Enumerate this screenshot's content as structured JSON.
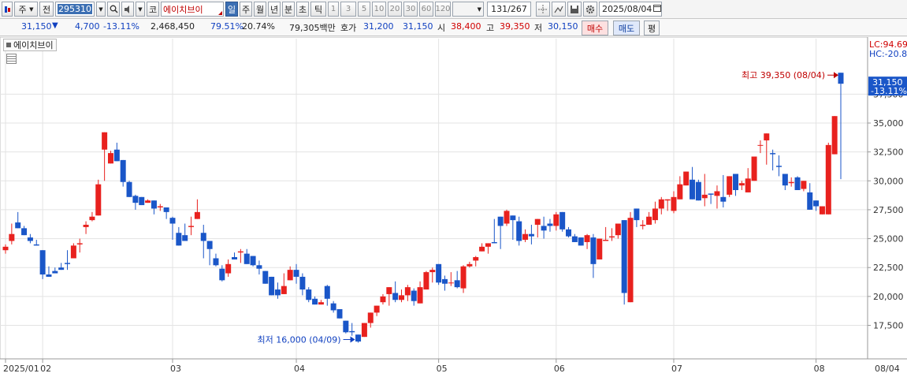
{
  "toolbar": {
    "market_label": "주",
    "prev_label": "전",
    "code": "295310",
    "name": "에이치브이",
    "periods": [
      "일",
      "주",
      "월",
      "년",
      "분",
      "초",
      "틱"
    ],
    "active_period": "일",
    "minute_options": [
      "1",
      "3",
      "5",
      "10",
      "20",
      "30",
      "60",
      "120"
    ],
    "count": "131",
    "total": "/267",
    "date": "2025/08/04",
    "ko_label": "코"
  },
  "quote": {
    "price": "31,150",
    "change": "4,700",
    "change_rate": "-13.11%",
    "volume": "2,468,450",
    "vol_ratio": "79.51%",
    "turnover": "20.74%",
    "amount": "79,305백만",
    "bid_label": "호가",
    "bid": "31,200",
    "ask": "31,150",
    "open_label": "시",
    "open": "38,400",
    "high_label": "고",
    "high": "39,350",
    "low_label": "저",
    "low": "30,150",
    "buy_label": "매수",
    "sell_label": "매도",
    "eval_label": "평"
  },
  "chart_data": {
    "type": "candlestick",
    "title": "에이치브이",
    "ylim": [
      14600,
      42300
    ],
    "y_ticks": [
      37500,
      35000,
      32500,
      30000,
      27500,
      25000,
      22500,
      20000,
      17500
    ],
    "y_tick_labels": [
      "37,500",
      "35,000",
      "32,500",
      "30,000",
      "27,500",
      "25,000",
      "22,500",
      "20,000",
      "17,500"
    ],
    "x_labels": [
      {
        "label": "2025/01",
        "index": 0
      },
      {
        "label": "02",
        "index": 6
      },
      {
        "label": "03",
        "index": 27
      },
      {
        "label": "04",
        "index": 47
      },
      {
        "label": "05",
        "index": 70
      },
      {
        "label": "06",
        "index": 89
      },
      {
        "label": "07",
        "index": 108
      },
      {
        "label": "08",
        "index": 131
      }
    ],
    "x_end_label": "08/04",
    "lc_label": "LC:94.69",
    "hc_label": "HC:-20.8",
    "current_price": "31,150",
    "current_rate": "-13.11%",
    "max_annotation": "최고 39,350 (08/04)",
    "min_annotation": "최저 16,000 (04/09)",
    "candles": [
      [
        24000,
        24300,
        23700,
        24500
      ],
      [
        24800,
        25400,
        24500,
        26300
      ],
      [
        26400,
        25900,
        26700,
        27300
      ],
      [
        25900,
        25300,
        26100,
        25300
      ],
      [
        25100,
        24800,
        25400,
        24600
      ],
      [
        24500,
        24400,
        24800,
        24900
      ],
      [
        24000,
        21900,
        24000,
        21500
      ],
      [
        21900,
        21700,
        22100,
        22600
      ],
      [
        22200,
        22000,
        22500,
        22300
      ],
      [
        22500,
        22300,
        22900,
        22500
      ],
      [
        22900,
        22800,
        24000,
        22300
      ],
      [
        23300,
        24400,
        24600,
        23500
      ],
      [
        24500,
        24600,
        25000,
        23800
      ],
      [
        26000,
        26200,
        26500,
        25400
      ],
      [
        26600,
        26900,
        27300,
        26500
      ],
      [
        27000,
        29700,
        30100,
        27100
      ],
      [
        32700,
        34200,
        30000,
        30100
      ],
      [
        31500,
        32400,
        32000,
        32600
      ],
      [
        32700,
        31700,
        33300,
        31700
      ],
      [
        31800,
        29900,
        31800,
        29500
      ],
      [
        29900,
        28600,
        30000,
        28700
      ],
      [
        28700,
        28100,
        28800,
        27500
      ],
      [
        28600,
        27900,
        28600,
        28400
      ],
      [
        28100,
        28300,
        28400,
        28300
      ],
      [
        28300,
        27600,
        28100,
        27100
      ],
      [
        27700,
        27800,
        28000,
        27400
      ],
      [
        27700,
        27300,
        27400,
        26700
      ],
      [
        26800,
        26300,
        26900,
        24900
      ],
      [
        25500,
        24400,
        26000,
        24600
      ],
      [
        25300,
        24800,
        26300,
        24900
      ],
      [
        26000,
        26100,
        26900,
        25300
      ],
      [
        26700,
        27300,
        28400,
        27400
      ],
      [
        25500,
        24800,
        26200,
        23300
      ],
      [
        24800,
        24100,
        24600,
        22700
      ],
      [
        23300,
        22700,
        23700,
        22600
      ],
      [
        22400,
        21400,
        22700,
        21300
      ],
      [
        22000,
        22800,
        23200,
        21700
      ],
      [
        23400,
        23200,
        23800,
        23200
      ],
      [
        23800,
        23900,
        24100,
        22900
      ],
      [
        23700,
        22800,
        24100,
        23200
      ],
      [
        23500,
        22700,
        23000,
        22600
      ],
      [
        22700,
        22400,
        23100,
        21900
      ],
      [
        22200,
        21100,
        22200,
        21400
      ],
      [
        21700,
        20100,
        21700,
        20200
      ],
      [
        20600,
        20100,
        21200,
        19800
      ],
      [
        20200,
        20900,
        22000,
        20700
      ],
      [
        21400,
        22300,
        22600,
        22000
      ],
      [
        22300,
        21700,
        22800,
        21100
      ],
      [
        21700,
        20600,
        22000,
        20100
      ],
      [
        20600,
        19700,
        20800,
        19500
      ],
      [
        19800,
        19300,
        20000,
        19400
      ],
      [
        19300,
        19500,
        19700,
        19500
      ],
      [
        20900,
        19800,
        21000,
        19200
      ],
      [
        19400,
        18800,
        19600,
        18600
      ],
      [
        18900,
        18100,
        18900,
        18100
      ],
      [
        17900,
        16900,
        17900,
        16800
      ],
      [
        17000,
        16900,
        17700,
        16600
      ],
      [
        16700,
        16100,
        16700,
        16000
      ],
      [
        16500,
        17700,
        17600,
        16600
      ],
      [
        17700,
        18600,
        18600,
        17300
      ],
      [
        18600,
        19200,
        19200,
        18300
      ],
      [
        19500,
        20000,
        20200,
        19300
      ],
      [
        20200,
        20800,
        20800,
        19200
      ],
      [
        20300,
        19700,
        21300,
        19500
      ],
      [
        19700,
        20100,
        20600,
        19500
      ],
      [
        20100,
        20800,
        21000,
        19600
      ],
      [
        20500,
        19600,
        20700,
        19200
      ],
      [
        19400,
        20800,
        21300,
        19400
      ],
      [
        20600,
        22100,
        22200,
        21200
      ],
      [
        22100,
        22300,
        22500,
        21200
      ],
      [
        22800,
        21200,
        22600,
        21000
      ],
      [
        21500,
        21100,
        21800,
        20500
      ],
      [
        21200,
        21200,
        22100,
        20900
      ],
      [
        21400,
        20800,
        22200,
        20700
      ],
      [
        20700,
        22600,
        22700,
        20300
      ],
      [
        22600,
        22800,
        23000,
        22500
      ],
      [
        23100,
        23400,
        23500,
        22600
      ],
      [
        23900,
        24300,
        24600,
        23900
      ],
      [
        24300,
        24600,
        24600,
        23700
      ],
      [
        24700,
        24600,
        26700,
        24600
      ],
      [
        26900,
        26100,
        26900,
        24100
      ],
      [
        26300,
        27400,
        27500,
        26100
      ],
      [
        27000,
        26600,
        26500,
        24900
      ],
      [
        26500,
        24800,
        26900,
        24400
      ],
      [
        24900,
        25400,
        25800,
        24700
      ],
      [
        25400,
        25200,
        26200,
        24500
      ],
      [
        26200,
        26700,
        26700,
        25100
      ],
      [
        26100,
        25700,
        26900,
        25000
      ],
      [
        26300,
        26100,
        26700,
        25600
      ],
      [
        26100,
        27100,
        27300,
        25700
      ],
      [
        27300,
        25800,
        27100,
        25600
      ],
      [
        25800,
        25200,
        26000,
        25100
      ],
      [
        25200,
        24700,
        25400,
        24800
      ],
      [
        25100,
        24400,
        24900,
        24500
      ],
      [
        24700,
        25300,
        25400,
        24100
      ],
      [
        25100,
        22800,
        25400,
        21600
      ],
      [
        23200,
        25000,
        25000,
        23200
      ],
      [
        24800,
        24900,
        26000,
        24900
      ],
      [
        25100,
        25200,
        25900,
        24800
      ],
      [
        25300,
        26300,
        26000,
        25000
      ],
      [
        26600,
        20300,
        19300,
        26400
      ],
      [
        19500,
        26800,
        27300,
        19600
      ],
      [
        27600,
        26600,
        26600,
        26000
      ],
      [
        26100,
        26200,
        26600,
        25800
      ],
      [
        26200,
        26900,
        27300,
        26300
      ],
      [
        26600,
        27600,
        28200,
        26300
      ],
      [
        27600,
        28400,
        28600,
        27100
      ],
      [
        28300,
        28400,
        28200,
        27400
      ],
      [
        27400,
        28600,
        29100,
        27200
      ],
      [
        28400,
        29700,
        30400,
        28400
      ],
      [
        29600,
        30800,
        30800,
        29600
      ],
      [
        30100,
        28400,
        31200,
        28500
      ],
      [
        29900,
        28300,
        30100,
        28600
      ],
      [
        28500,
        28800,
        30600,
        27800
      ],
      [
        28900,
        28800,
        28900,
        28000
      ],
      [
        28700,
        29100,
        29600,
        27600
      ],
      [
        28600,
        28200,
        30500,
        27700
      ],
      [
        28800,
        30400,
        30400,
        28600
      ],
      [
        30600,
        29200,
        30600,
        28700
      ],
      [
        29600,
        29800,
        30000,
        29200
      ],
      [
        29000,
        30200,
        31100,
        29300
      ],
      [
        30000,
        32100,
        32000,
        30700
      ],
      [
        33100,
        33100,
        33500,
        32400
      ],
      [
        33500,
        34100,
        33800,
        31400
      ],
      [
        32400,
        32300,
        32700,
        30900
      ],
      [
        31300,
        31200,
        32200,
        30400
      ],
      [
        30600,
        29600,
        30300,
        29200
      ],
      [
        29800,
        29900,
        30300,
        29500
      ],
      [
        30300,
        29200,
        30400,
        29800
      ],
      [
        29300,
        30000,
        29100,
        29200
      ],
      [
        29000,
        27500,
        27600,
        29800
      ],
      [
        28300,
        27800,
        28100,
        27400
      ],
      [
        27100,
        27800,
        27800,
        27200
      ],
      [
        27100,
        33100,
        33300,
        27300
      ],
      [
        32300,
        35600,
        35600,
        32500
      ],
      [
        39350,
        38400,
        31150,
        30150
      ]
    ]
  }
}
